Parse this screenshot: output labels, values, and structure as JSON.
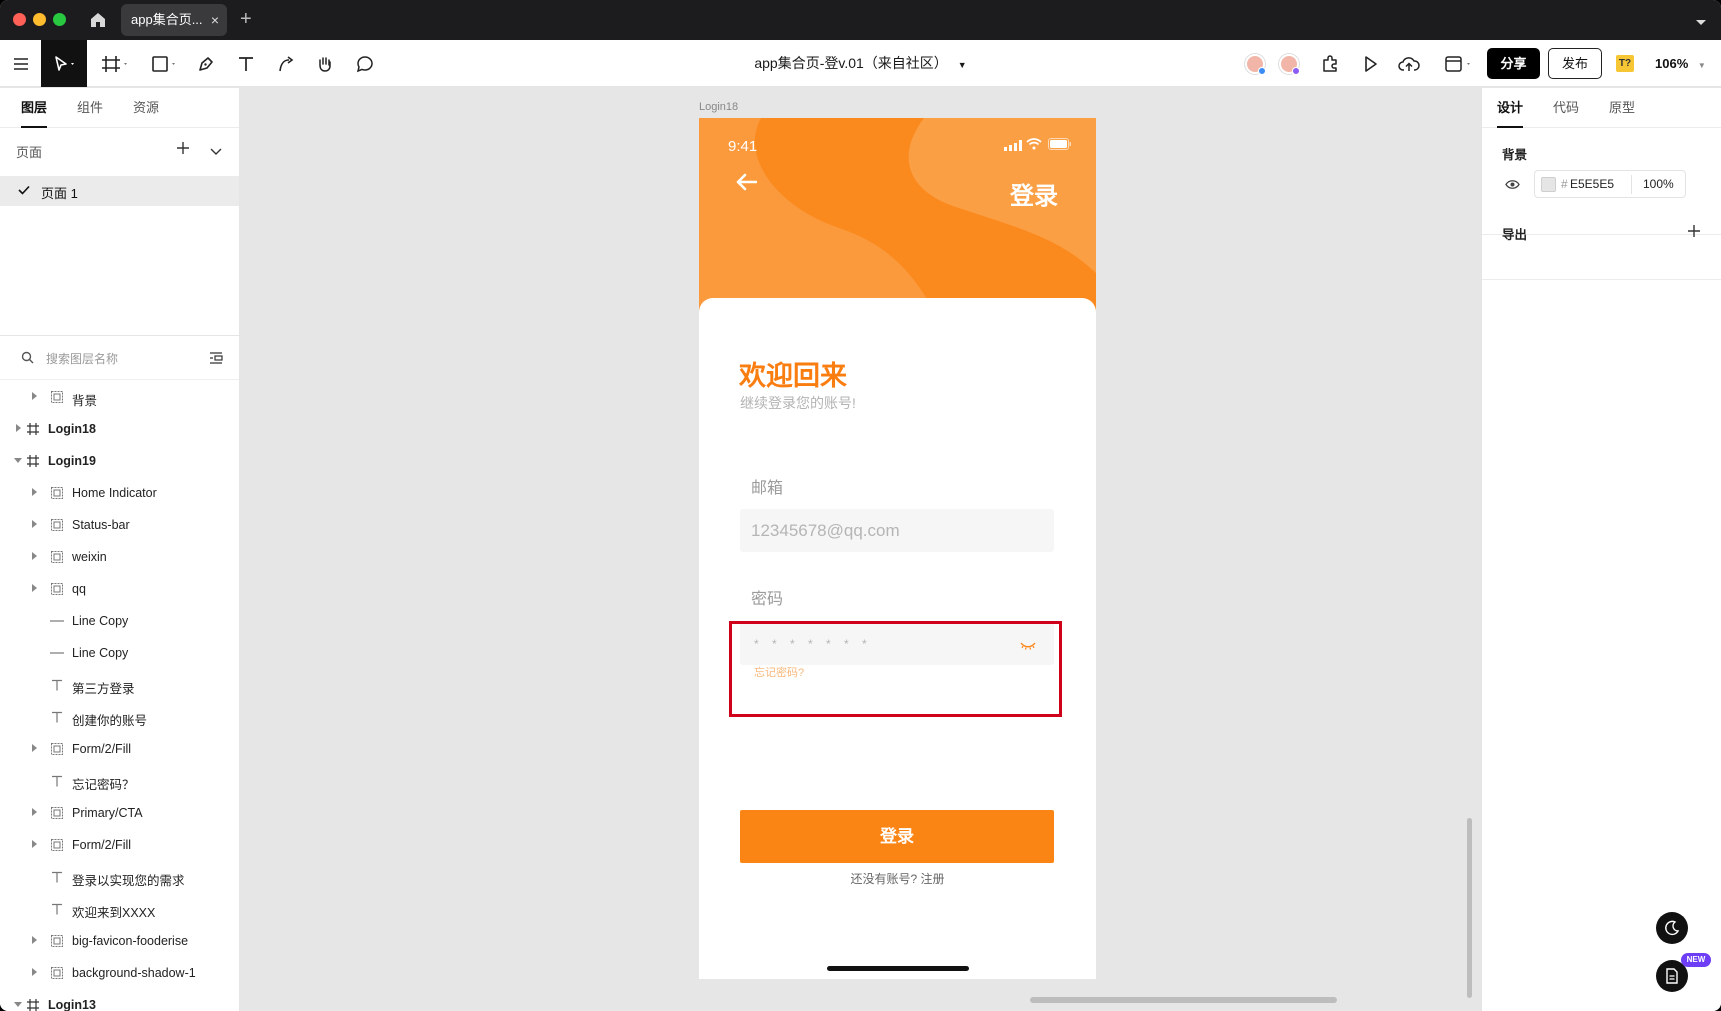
{
  "window": {
    "tab_title": "app集合页...",
    "document_title": "app集合页-登v.01（来自社区）"
  },
  "toolbar": {
    "share_label": "分享",
    "publish_label": "发布",
    "plugin_badge": "T?",
    "zoom": "106%"
  },
  "left_panel": {
    "tabs": [
      "图层",
      "组件",
      "资源"
    ],
    "pages_label": "页面",
    "current_page": "页面 1",
    "search_placeholder": "搜索图层名称",
    "layers": [
      {
        "name": "背景",
        "type": "group",
        "depth": 1,
        "expand": "collapsed"
      },
      {
        "name": "Login18",
        "type": "frame",
        "depth": 0,
        "expand": "collapsed"
      },
      {
        "name": "Login19",
        "type": "frame",
        "depth": 0,
        "expand": "expanded"
      },
      {
        "name": "Home Indicator",
        "type": "group",
        "depth": 1,
        "expand": "collapsed"
      },
      {
        "name": "Status-bar",
        "type": "group",
        "depth": 1,
        "expand": "collapsed"
      },
      {
        "name": "weixin",
        "type": "group",
        "depth": 1,
        "expand": "collapsed"
      },
      {
        "name": "qq",
        "type": "group",
        "depth": 1,
        "expand": "collapsed"
      },
      {
        "name": "Line Copy",
        "type": "line",
        "depth": 1,
        "expand": "none"
      },
      {
        "name": "Line Copy",
        "type": "line",
        "depth": 1,
        "expand": "none"
      },
      {
        "name": "第三方登录",
        "type": "text",
        "depth": 1,
        "expand": "none"
      },
      {
        "name": "创建你的账号",
        "type": "text",
        "depth": 1,
        "expand": "none"
      },
      {
        "name": "Form/2/Fill",
        "type": "group",
        "depth": 1,
        "expand": "collapsed"
      },
      {
        "name": "忘记密码？",
        "type": "text",
        "depth": 1,
        "expand": "none"
      },
      {
        "name": "Primary/CTA",
        "type": "group",
        "depth": 1,
        "expand": "collapsed"
      },
      {
        "name": "Form/2/Fill",
        "type": "group",
        "depth": 1,
        "expand": "collapsed"
      },
      {
        "name": "登录以实现您的需求",
        "type": "text",
        "depth": 1,
        "expand": "none"
      },
      {
        "name": "欢迎来到XXXX",
        "type": "text",
        "depth": 1,
        "expand": "none"
      },
      {
        "name": "big-favicon-fooderise",
        "type": "group",
        "depth": 1,
        "expand": "collapsed"
      },
      {
        "name": "background-shadow-1",
        "type": "group",
        "depth": 1,
        "expand": "collapsed"
      },
      {
        "name": "Login13",
        "type": "frame",
        "depth": 0,
        "expand": "expanded"
      }
    ]
  },
  "canvas": {
    "frame_label": "Login18",
    "phone": {
      "status_time": "9:41",
      "header_title": "登录",
      "welcome": "欢迎回来",
      "welcome_sub": "继续登录您的账号!",
      "email_label": "邮箱",
      "email_value": "12345678@qq.com",
      "password_label": "密码",
      "password_value": "* * * * * * *",
      "forgot": "忘记密码?",
      "login_button": "登录",
      "register": "还没有账号? 注册"
    }
  },
  "right_panel": {
    "tabs": [
      "设计",
      "代码",
      "原型"
    ],
    "background_title": "背景",
    "background_hex": "E5E5E5",
    "background_opacity": "100%",
    "export_title": "导出"
  },
  "colors": {
    "accent_orange": "#fb8514",
    "header_orange": "#fb9a3c",
    "highlight_red": "#d0021b",
    "canvas_bg": "#e6e6e6"
  },
  "floating": {
    "new_badge": "NEW"
  }
}
